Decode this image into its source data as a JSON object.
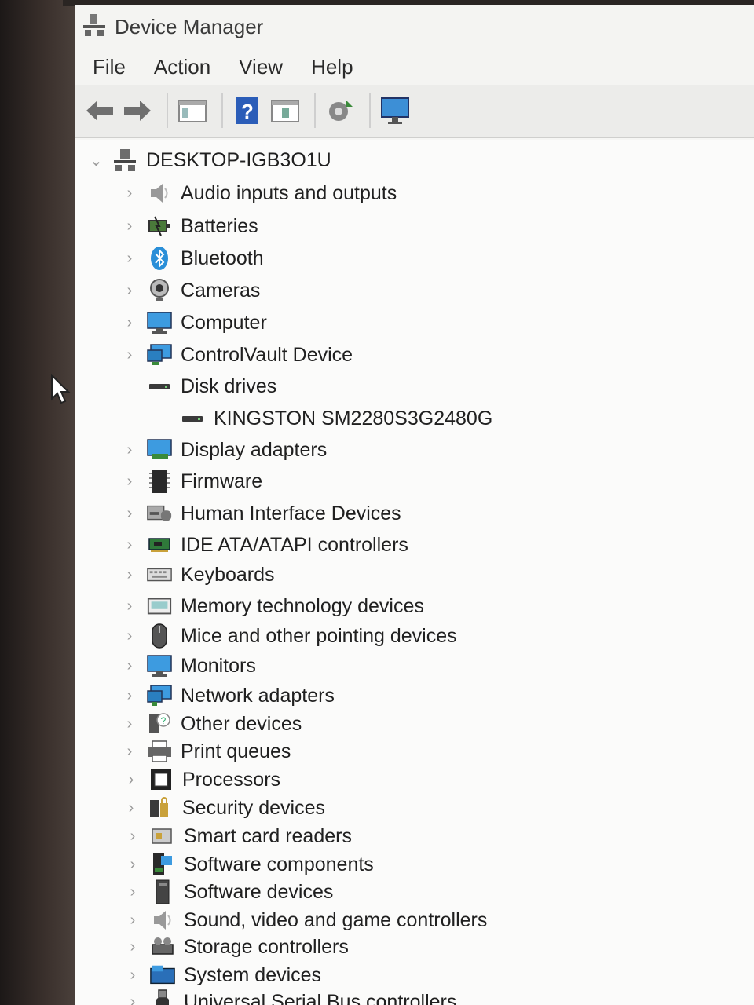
{
  "window": {
    "title": "Device Manager"
  },
  "menu": [
    "File",
    "Action",
    "View",
    "Help"
  ],
  "toolbar": {
    "icons": [
      "back-arrow-icon",
      "forward-arrow-icon",
      "properties-icon",
      "help-icon",
      "view-icon",
      "scan-hardware-icon",
      "monitor-icon"
    ]
  },
  "tree": {
    "root": {
      "label": "DESKTOP-IGB3O1U",
      "expanded": true
    },
    "categories": [
      {
        "label": "Audio inputs and outputs",
        "icon": "speaker-icon"
      },
      {
        "label": "Batteries",
        "icon": "battery-icon"
      },
      {
        "label": "Bluetooth",
        "icon": "bluetooth-icon"
      },
      {
        "label": "Cameras",
        "icon": "camera-icon"
      },
      {
        "label": "Computer",
        "icon": "computer-icon"
      },
      {
        "label": "ControlVault Device",
        "icon": "controlvault-icon"
      },
      {
        "label": "Disk drives",
        "icon": "disk-drive-icon",
        "expanded": true,
        "children": [
          {
            "label": "KINGSTON SM2280S3G2480G",
            "icon": "disk-drive-icon"
          }
        ]
      },
      {
        "label": "Display adapters",
        "icon": "display-adapter-icon"
      },
      {
        "label": "Firmware",
        "icon": "firmware-icon"
      },
      {
        "label": "Human Interface Devices",
        "icon": "hid-icon"
      },
      {
        "label": "IDE ATA/ATAPI controllers",
        "icon": "ide-controller-icon"
      },
      {
        "label": "Keyboards",
        "icon": "keyboard-icon"
      },
      {
        "label": "Memory technology devices",
        "icon": "memory-icon"
      },
      {
        "label": "Mice and other pointing devices",
        "icon": "mouse-icon"
      },
      {
        "label": "Monitors",
        "icon": "monitor-icon"
      },
      {
        "label": "Network adapters",
        "icon": "network-adapter-icon"
      },
      {
        "label": "Other devices",
        "icon": "other-devices-icon"
      },
      {
        "label": "Print queues",
        "icon": "printer-icon"
      },
      {
        "label": "Processors",
        "icon": "processor-icon"
      },
      {
        "label": "Security devices",
        "icon": "security-icon"
      },
      {
        "label": "Smart card readers",
        "icon": "smart-card-icon"
      },
      {
        "label": "Software components",
        "icon": "software-components-icon"
      },
      {
        "label": "Software devices",
        "icon": "software-devices-icon"
      },
      {
        "label": "Sound, video and game controllers",
        "icon": "sound-icon"
      },
      {
        "label": "Storage controllers",
        "icon": "storage-controller-icon"
      },
      {
        "label": "System devices",
        "icon": "system-devices-icon"
      },
      {
        "label": "Universal Serial Bus controllers",
        "icon": "usb-icon"
      }
    ]
  },
  "colors": {
    "window_bg": "#f6f6f4",
    "accent_blue": "#2a8fd8"
  }
}
